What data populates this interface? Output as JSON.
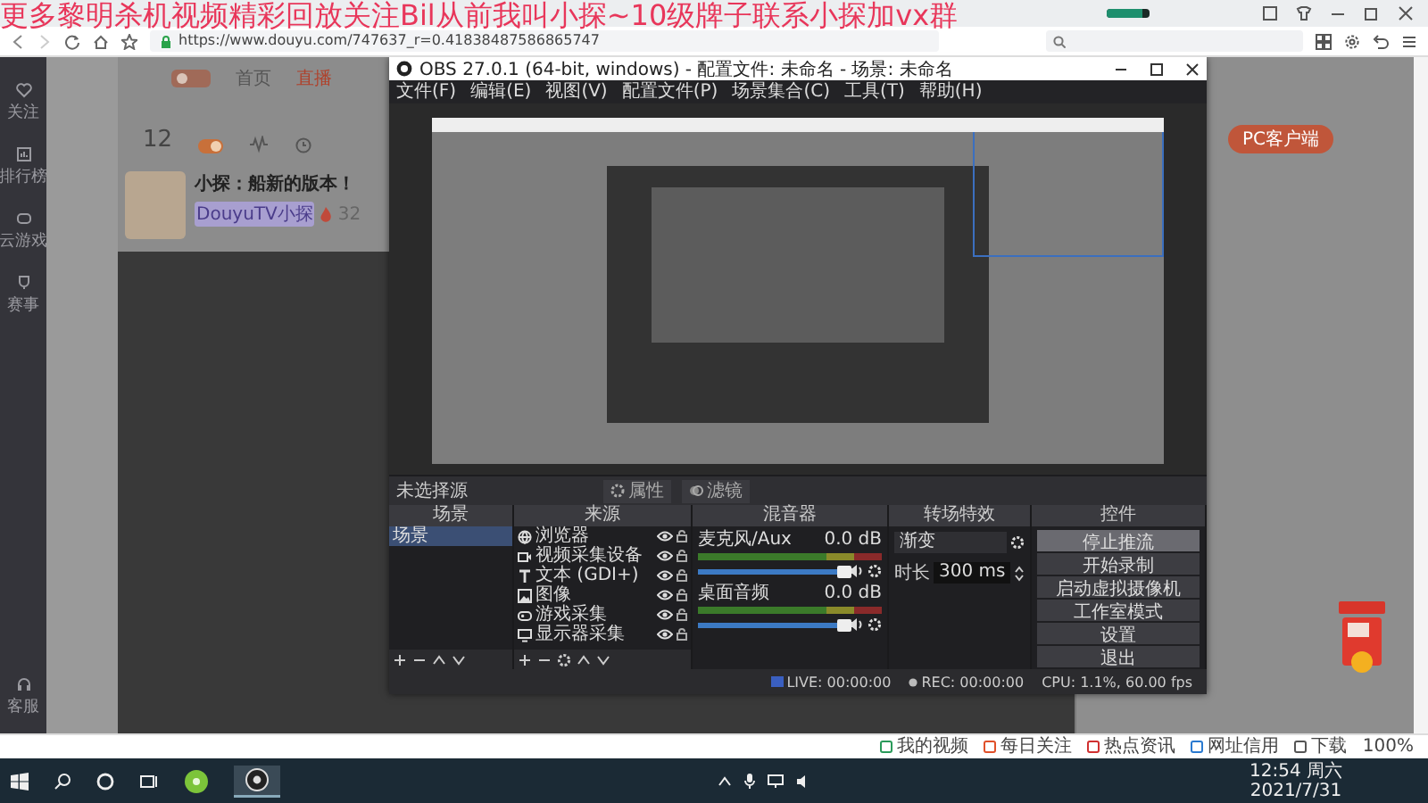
{
  "overlay_text": "更多黎明杀机视频精彩回放关注Bil从前我叫小探~10级牌子联系小探加vx群",
  "browser": {
    "url": "https://www.douyu.com/747637_r=0.41838487586865747",
    "progress": {
      "level": 0.85
    }
  },
  "page": {
    "sidebar": [
      "关注",
      "排行榜",
      "云游戏",
      "赛事",
      "客服"
    ],
    "nav": [
      {
        "label": "首页",
        "selected": false
      },
      {
        "label": "直播",
        "selected": true
      }
    ],
    "follow_count": "12",
    "streamer": {
      "title": "小探：船新的版本！",
      "name": "DouyuTV小探",
      "hot": "32"
    },
    "client_button": "PC客户端"
  },
  "obs": {
    "title": "OBS 27.0.1 (64-bit, windows) - 配置文件: 未命名 - 场景: 未命名",
    "menu": [
      "文件(F)",
      "编辑(E)",
      "视图(V)",
      "配置文件(P)",
      "场景集合(C)",
      "工具(T)",
      "帮助(H)"
    ],
    "source_bar": {
      "label": "未选择源",
      "buttons": [
        {
          "kind": "properties",
          "label": "属性"
        },
        {
          "kind": "filters",
          "label": "滤镜"
        }
      ]
    },
    "scenes": {
      "title": "场景",
      "items": [
        {
          "label": "场景",
          "selected": true
        }
      ]
    },
    "sources": {
      "title": "来源",
      "items": [
        {
          "kind": "browser",
          "label": "浏览器",
          "selected": false,
          "visible": true
        },
        {
          "kind": "camera",
          "label": "视频采集设备",
          "selected": false,
          "visible": true
        },
        {
          "kind": "text",
          "label": "文本 (GDI+)",
          "selected": false,
          "visible": true
        },
        {
          "kind": "image",
          "label": "图像",
          "selected": false,
          "visible": true
        },
        {
          "kind": "game",
          "label": "游戏采集",
          "selected": false,
          "visible": true
        },
        {
          "kind": "display",
          "label": "显示器采集",
          "selected": false,
          "visible": true
        }
      ]
    },
    "mixer": {
      "title": "混音器",
      "channels": [
        {
          "name": "麦克风/Aux",
          "reading": "0.0 dB",
          "level": 1
        },
        {
          "name": "桌面音频",
          "reading": "0.0 dB",
          "level": 1
        }
      ]
    },
    "transitions": {
      "title": "转场特效",
      "type": "渐变",
      "duration_label": "时长",
      "duration": "300 ms"
    },
    "controls": {
      "title": "控件",
      "buttons": [
        "停止推流",
        "开始录制",
        "启动虚拟摄像机",
        "工作室模式",
        "设置",
        "退出"
      ]
    },
    "status": {
      "live": "LIVE: 00:00:00",
      "rec": "REC: 00:00:00",
      "cpu": "CPU: 1.1%, 60.00 fps"
    }
  },
  "status_bar": {
    "items": [
      "我的视频",
      "每日关注",
      "热点资讯",
      "网址信用",
      "下载"
    ],
    "zoom": "100%"
  },
  "taskbar": {
    "time": "12:54 周六",
    "date": "2021/7/31"
  }
}
